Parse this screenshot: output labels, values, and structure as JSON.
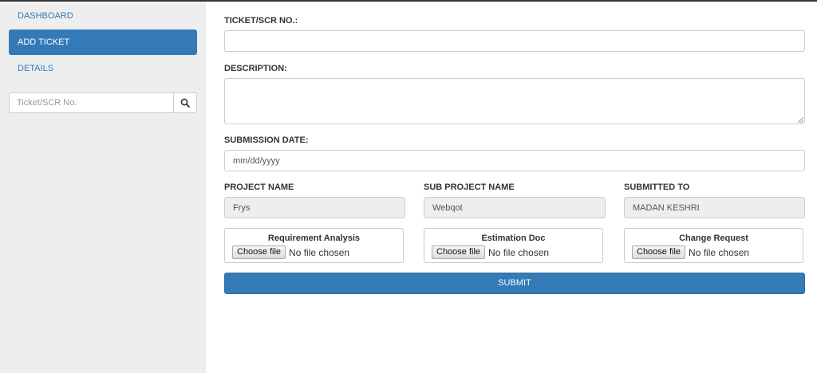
{
  "sidebar": {
    "items": [
      {
        "label": "DASHBOARD"
      },
      {
        "label": "ADD TICKET"
      },
      {
        "label": "DETAILS"
      }
    ],
    "search": {
      "placeholder": "Ticket/SCR No.",
      "icon": "search-icon"
    }
  },
  "form": {
    "ticket": {
      "label": "TICKET/SCR NO.:",
      "value": ""
    },
    "description": {
      "label": "DESCRIPTION:",
      "value": ""
    },
    "submission_date": {
      "label": "SUBMISSION DATE:",
      "placeholder": "mm/dd/yyyy"
    },
    "project_name": {
      "label": "PROJECT NAME",
      "value": "Frys"
    },
    "sub_project_name": {
      "label": "SUB PROJECT NAME",
      "value": "Webqot"
    },
    "submitted_to": {
      "label": "SUBMITTED TO",
      "value": "MADAN KESHRI"
    },
    "files": [
      {
        "title": "Requirement Analysis",
        "button": "Choose file",
        "status": "No file chosen"
      },
      {
        "title": "Estimation Doc",
        "button": "Choose file",
        "status": "No file chosen"
      },
      {
        "title": "Change Request",
        "button": "Choose file",
        "status": "No file chosen"
      }
    ],
    "submit_label": "SUBMIT"
  },
  "colors": {
    "accent": "#337ab7",
    "sidebar_bg": "#eeeeee",
    "readonly_bg": "#eeeeee"
  }
}
